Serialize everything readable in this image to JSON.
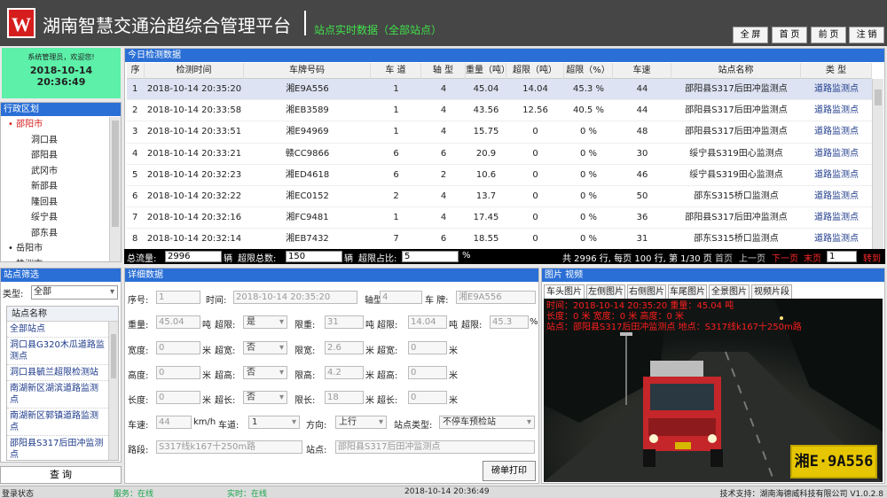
{
  "header": {
    "logo_text": "W",
    "title": "湖南智慧交通治超综合管理平台",
    "subtitle": "站点实时数据（全部站点）",
    "buttons": [
      "全 屏",
      "首 页",
      "前 页",
      "注 销"
    ]
  },
  "welcome": {
    "greeting": "系统管理员，欢迎您!",
    "date": "2018-10-14",
    "time": "20:36:49"
  },
  "region": {
    "title": "行政区划",
    "items": [
      {
        "label": "邵阳市",
        "level": 1,
        "selected": true
      },
      {
        "label": "洞口县",
        "level": 2
      },
      {
        "label": "邵阳县",
        "level": 2
      },
      {
        "label": "武冈市",
        "level": 2
      },
      {
        "label": "新邵县",
        "level": 2
      },
      {
        "label": "隆回县",
        "level": 2
      },
      {
        "label": "绥宁县",
        "level": 2
      },
      {
        "label": "邵东县",
        "level": 2
      },
      {
        "label": "岳阳市",
        "level": 1
      },
      {
        "label": "株洲市",
        "level": 1
      }
    ]
  },
  "station_filter": {
    "title": "站点筛选",
    "type_label": "类型:",
    "type_value": "全部",
    "list_header": "站点名称",
    "items": [
      "全部站点",
      "洞口县G320木瓜道路监测点",
      "洞口县毓兰超限检测站",
      "南湖新区湖滨道路监测点",
      "南湖新区郭镇道路监测点",
      "邵阳县S317后田冲监测点"
    ],
    "query_button": "查 询"
  },
  "today": {
    "title": "今日检测数据",
    "columns": [
      "序号",
      "检测时间",
      "车牌号码",
      "车 道",
      "轴 型",
      "重量（吨）",
      "超限（吨）",
      "超限（%）",
      "车速",
      "站点名称",
      "类 型"
    ],
    "rows": [
      [
        "1",
        "2018-10-14 20:35:20",
        "湘E9A556",
        "1",
        "4",
        "45.04",
        "14.04",
        "45.3 %",
        "44",
        "邵阳县S317后田冲监测点",
        "道路监测点"
      ],
      [
        "2",
        "2018-10-14 20:33:58",
        "湘EB3589",
        "1",
        "4",
        "43.56",
        "12.56",
        "40.5 %",
        "44",
        "邵阳县S317后田冲监测点",
        "道路监测点"
      ],
      [
        "3",
        "2018-10-14 20:33:51",
        "湘E94969",
        "1",
        "4",
        "15.75",
        "0",
        "0 %",
        "48",
        "邵阳县S317后田冲监测点",
        "道路监测点"
      ],
      [
        "4",
        "2018-10-14 20:33:21",
        "赣CC9866",
        "6",
        "6",
        "20.9",
        "0",
        "0 %",
        "30",
        "绥宁县S319田心监测点",
        "道路监测点"
      ],
      [
        "5",
        "2018-10-14 20:32:23",
        "湘ED4618",
        "6",
        "2",
        "10.6",
        "0",
        "0 %",
        "46",
        "绥宁县S319田心监测点",
        "道路监测点"
      ],
      [
        "6",
        "2018-10-14 20:32:22",
        "湘EC0152",
        "2",
        "4",
        "13.7",
        "0",
        "0 %",
        "50",
        "邵东S315桥口监测点",
        "道路监测点"
      ],
      [
        "7",
        "2018-10-14 20:32:16",
        "湘FC9481",
        "1",
        "4",
        "17.45",
        "0",
        "0 %",
        "36",
        "邵阳县S317后田冲监测点",
        "道路监测点"
      ],
      [
        "8",
        "2018-10-14 20:32:14",
        "湘EB7432",
        "7",
        "6",
        "18.55",
        "0",
        "0 %",
        "31",
        "邵东S315桥口监测点",
        "道路监测点"
      ]
    ],
    "totals": {
      "total_label": "总流量:",
      "total_value": "2996",
      "unit1": "辆",
      "over_label": "超限总数:",
      "over_value": "150",
      "unit2": "辆",
      "ratio_label": "超限占比:",
      "ratio_value": "5",
      "unit3": "%",
      "pager_info": "共 2996 行, 每页 100 行, 第 1/30 页",
      "first": "首页",
      "prev": "上一页",
      "next": "下一页",
      "last": "末页",
      "page_value": "1",
      "goto": "转到"
    }
  },
  "detail": {
    "title": "详细数据",
    "seq_label": "序号:",
    "seq": "1",
    "time_label": "时间:",
    "time": "2018-10-14 20:35:20",
    "axle_label": "轴型:",
    "axle": "4",
    "plate_label": "车 牌:",
    "plate": "湘E9A556",
    "weight_label": "重量:",
    "weight": "45.04",
    "ton": "吨",
    "limit_label": "超限:",
    "limit_sel": "是",
    "limitw_label": "限重:",
    "limitw": "31",
    "overw_label": "超限:",
    "overw": "14.04",
    "overp_label": "超限:",
    "overp": "45.3",
    "pct": "%",
    "width_label": "宽度:",
    "width": "0",
    "m": "米",
    "ow_label": "超宽:",
    "ow_sel": "否",
    "lw_label": "限宽:",
    "lw": "2.6",
    "ow2_label": "超宽:",
    "ow2": "0",
    "height_label": "高度:",
    "height": "0",
    "oh_label": "超高:",
    "oh_sel": "否",
    "lh_label": "限高:",
    "lh": "4.2",
    "oh2_label": "超高:",
    "oh2": "0",
    "length_label": "长度:",
    "length": "0",
    "ol_label": "超长:",
    "ol_sel": "否",
    "ll_label": "限长:",
    "ll": "18",
    "ol2_label": "超长:",
    "ol2": "0",
    "speed_label": "车速:",
    "speed": "44",
    "speed_unit": "km/h",
    "lane_label": "车道:",
    "lane": "1",
    "dir_label": "方向:",
    "dir": "上行",
    "stype_label": "站点类型:",
    "stype": "不停车预检站",
    "road_label": "路段:",
    "road": "S317线k167十250m路",
    "site_label": "站点:",
    "site": "邵阳县S317后田冲监测点",
    "print": "磅单打印"
  },
  "photos": {
    "title": "图片 视频",
    "tabs": [
      "车头图片",
      "左侧图片",
      "右侧图片",
      "车尾图片",
      "全景图片",
      "视频片段"
    ],
    "overlay": [
      "时间：2018-10-14 20:35:20  重量：45.04 吨",
      "长度：0 米  宽度：0 米  高度：0 米",
      "站点：邵阳县S317后田冲监测点  地点：S317线k167十250m路"
    ],
    "plate": "湘E·9A556"
  },
  "status": {
    "login": "登录状态",
    "service": "服务：在线",
    "realtime": "实时：在线",
    "datetime": "2018-10-14 20:36:49",
    "support": "技术支持：湖南海德威科技有限公司 V1.0.2.8"
  },
  "colors": {
    "header_bg": "#464646",
    "panel_title": "#2a6fd6",
    "subtitle_green": "#3fe04a",
    "welcome_bg": "#5cf0a8",
    "selected_row": "#dde3f2",
    "overlay_red": "#ff1e1e"
  }
}
